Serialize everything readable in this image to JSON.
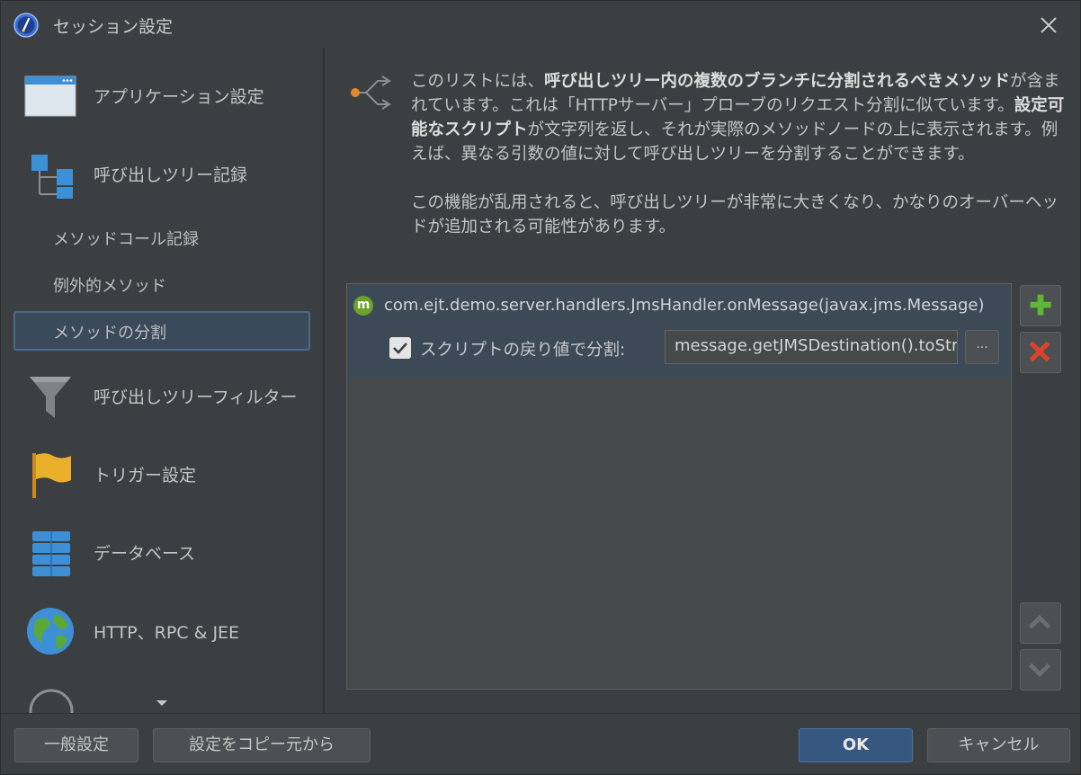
{
  "window": {
    "title": "セッション設定"
  },
  "sidebar": {
    "items": [
      {
        "label": "アプリケーション設定",
        "icon": "application-window-icon"
      },
      {
        "label": "呼び出しツリー記録",
        "icon": "call-tree-icon"
      },
      {
        "label": "メソッドコール記録"
      },
      {
        "label": "例外的メソッド"
      },
      {
        "label": "メソッドの分割",
        "selected": true
      },
      {
        "label": "呼び出しツリーフィルター",
        "icon": "funnel-icon"
      },
      {
        "label": "トリガー設定",
        "icon": "flag-icon"
      },
      {
        "label": "データベース",
        "icon": "database-icon"
      },
      {
        "label": "HTTP、RPC & JEE",
        "icon": "globe-icon"
      }
    ]
  },
  "description": {
    "p1": [
      {
        "text": "このリストには、"
      },
      {
        "text": "呼び出しツリー内の複数のブランチに分割されるべきメソッド",
        "bold": true
      },
      {
        "text": "が含まれています。これは「HTTPサーバー」プローブのリクエスト分割に似ています。"
      },
      {
        "text": "設定可能なスクリプト",
        "bold": true
      },
      {
        "text": "が文字列を返し、それが実際のメソッドノードの上に表示されます。例えば、異なる引数の値に対して呼び出しツリーを分割することができます。"
      }
    ],
    "p2": "この機能が乱用されると、呼び出しツリーが非常に大きくなり、かなりのオーバーヘッドが追加される可能性があります。"
  },
  "list": {
    "entries": [
      {
        "badge": "m",
        "method": "com.ejt.demo.server.handlers.JmsHandler.onMessage(javax.jms.Message)",
        "split_checkbox_label": "スクリプトの戻り値で分割:",
        "split_checked": true,
        "script_value": "message.getJMSDestination().toString()",
        "more_button": "..."
      }
    ]
  },
  "buttons": {
    "general": "一般設定",
    "copy": "設定をコピー元から",
    "ok": "OK",
    "cancel": "キャンセル"
  },
  "colors": {
    "accent": "#365880",
    "selection": "#3c4a57",
    "add": "#5fb832",
    "remove": "#d9432b"
  }
}
